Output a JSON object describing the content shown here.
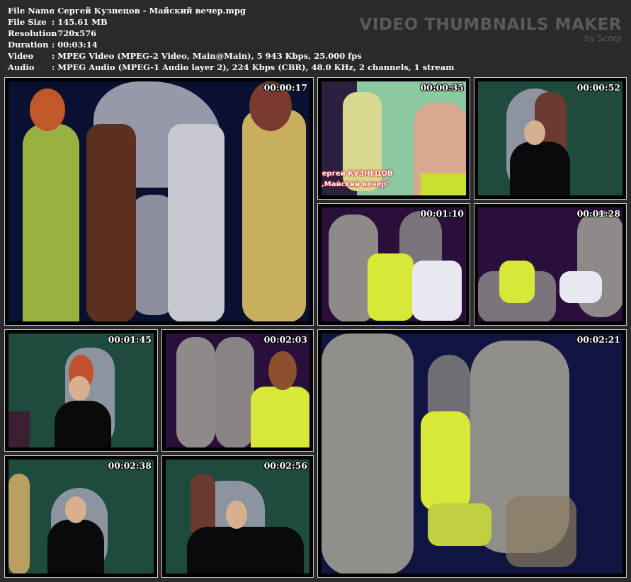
{
  "info": {
    "rows": [
      {
        "label": "File Name",
        "value": ": Сергей Кузнецов - Майский вечер.mpg"
      },
      {
        "label": "File Size",
        "value": ": 145.61 MB"
      },
      {
        "label": "Resolution",
        "value": ": 720x576"
      },
      {
        "label": "Duration",
        "value": ": 00:03:14"
      },
      {
        "label": "Video",
        "value": ": MPEG Video (MPEG-2 Video, Main@Main), 5 943 Kbps, 25.000 fps"
      },
      {
        "label": "Audio",
        "value": ": MPEG Audio (MPEG-1 Audio layer 2), 224 Kbps (CBR), 48.0 KHz, 2 channels, 1 stream"
      }
    ]
  },
  "brand": {
    "title": "VIDEO THUMBNAILS MAKER",
    "by": "by Scorp"
  },
  "thumbnails": [
    {
      "timestamp": "00:00:17"
    },
    {
      "timestamp": "00:00:35",
      "caption_line1": "Сергей КУЗНЕЦОВ",
      "caption_line2": "„Майский вечер\""
    },
    {
      "timestamp": "00:00:52"
    },
    {
      "timestamp": "00:01:10"
    },
    {
      "timestamp": "00:01:28"
    },
    {
      "timestamp": "00:01:45"
    },
    {
      "timestamp": "00:02:03"
    },
    {
      "timestamp": "00:02:21"
    },
    {
      "timestamp": "00:02:38"
    },
    {
      "timestamp": "00:02:56"
    }
  ],
  "colors": {
    "background": "#2a2a2a",
    "border": "#c8c8c8",
    "green_screen": "#1f4a3e",
    "purple_screen": "#2a0f3a",
    "navy_screen": "#0f1540"
  }
}
